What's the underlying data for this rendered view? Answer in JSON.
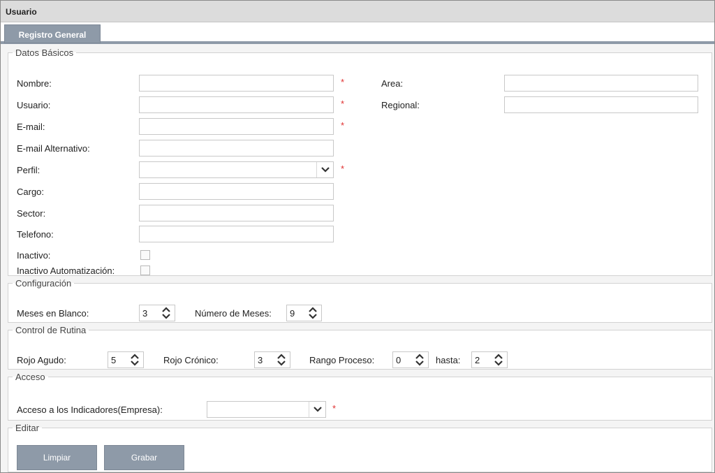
{
  "window": {
    "title": "Usuario"
  },
  "tabs": [
    {
      "label": "Registro General"
    }
  ],
  "datos_basicos": {
    "legend": "Datos Básicos",
    "required_mark": "*",
    "fields": {
      "nombre": {
        "label": "Nombre:",
        "value": ""
      },
      "usuario": {
        "label": "Usuario:",
        "value": ""
      },
      "email": {
        "label": "E-mail:",
        "value": ""
      },
      "email_alt": {
        "label": "E-mail Alternativo:",
        "value": ""
      },
      "perfil": {
        "label": "Perfil:",
        "value": ""
      },
      "cargo": {
        "label": "Cargo:",
        "value": ""
      },
      "sector": {
        "label": "Sector:",
        "value": ""
      },
      "telefono": {
        "label": "Telefono:",
        "value": ""
      },
      "area": {
        "label": "Area:",
        "value": ""
      },
      "regional": {
        "label": "Regional:",
        "value": ""
      },
      "inactivo": {
        "label": "Inactivo:",
        "checked": false
      },
      "inactivo_auto": {
        "label": "Inactivo Automatización:",
        "checked": false
      }
    }
  },
  "configuracion": {
    "legend": "Configuración",
    "meses_blanco": {
      "label": "Meses en Blanco:",
      "value": "3"
    },
    "numero_meses": {
      "label": "Número de Meses:",
      "value": "9"
    }
  },
  "control_rutina": {
    "legend": "Control de Rutina",
    "rojo_agudo": {
      "label": "Rojo Agudo:",
      "value": "5"
    },
    "rojo_cronico": {
      "label": "Rojo Crónico:",
      "value": "3"
    },
    "rango_proceso": {
      "label": "Rango Proceso:",
      "value": "0"
    },
    "hasta": {
      "label": "hasta:",
      "value": "2"
    }
  },
  "acceso": {
    "legend": "Acceso",
    "indicadores": {
      "label": "Acceso a los Indicadores(Empresa):",
      "value": ""
    }
  },
  "editar": {
    "legend": "Editar",
    "limpiar_label": "Limpiar",
    "grabar_label": "Grabar"
  },
  "colors": {
    "accent": "#8e9aa8",
    "required": "#e03030"
  }
}
